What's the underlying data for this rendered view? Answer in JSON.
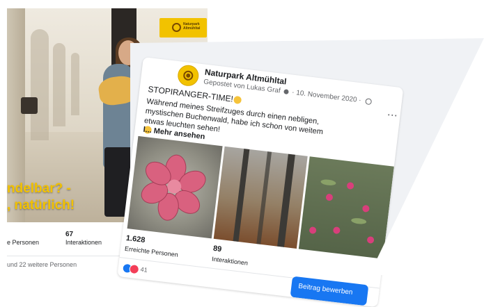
{
  "background_post": {
    "logo_text": "Naturpark Altmühltal",
    "caption_line1": "ndelbar? -",
    "caption_line2": ", natürlich!",
    "stat_a_label": "e Personen",
    "stat_b_value": "67",
    "stat_b_label": "Interaktionen",
    "likes_text": "und 22 weitere Personen"
  },
  "post": {
    "page_name": "Naturpark Altmühltal",
    "meta_prefix": "Gepostet von Lukas Graf",
    "meta_date": "· 10. November 2020 ·",
    "more_label": "···",
    "headline": "STOPIRANGER-TIME!",
    "body_lines": [
      "Während meines Streifzuges durch einen nebligen,",
      "mystischen Buchenwald, habe ich schon von weitem",
      "etwas leuchten sehen!"
    ],
    "see_more_prefix": "l...",
    "see_more_label": "Mehr ansehen",
    "reach_value": "1.628",
    "reach_label": "Erreichte Personen",
    "interactions_value": "89",
    "interactions_label": "Interaktionen",
    "reaction_count": "41",
    "boost_label": "Beitrag bewerben"
  },
  "colors": {
    "brand_yellow": "#f2c200",
    "facebook_blue": "#1877f2"
  }
}
